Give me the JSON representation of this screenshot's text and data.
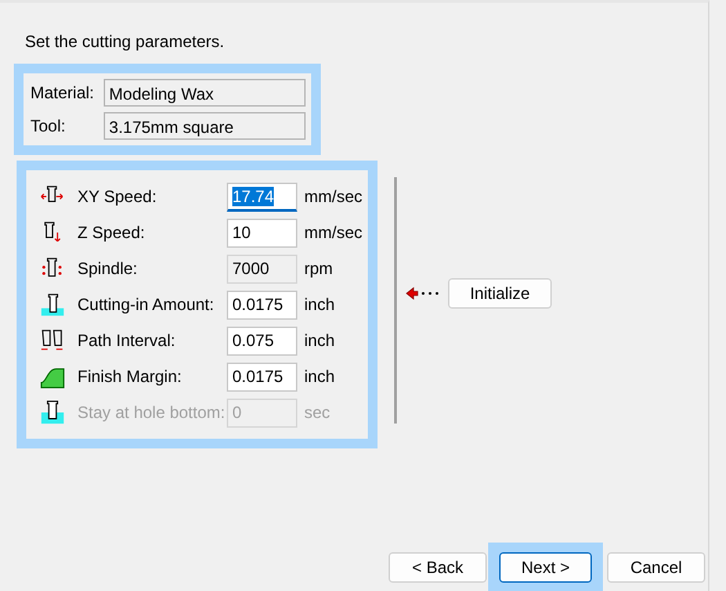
{
  "instruction": "Set the cutting parameters.",
  "tool_info": {
    "highlighted": true,
    "fields": [
      {
        "label": "Material:",
        "value": "Modeling Wax"
      },
      {
        "label": "Tool:",
        "value": "3.175mm square"
      }
    ]
  },
  "parameters": {
    "highlighted": true,
    "rows": [
      {
        "label": "XY Speed:",
        "value": "17.74",
        "unit": "mm/sec",
        "disabled": false,
        "focused": true,
        "readonly": false
      },
      {
        "label": "Z Speed:",
        "value": "10",
        "unit": "mm/sec",
        "disabled": false,
        "focused": false,
        "readonly": false
      },
      {
        "label": "Spindle:",
        "value": "7000",
        "unit": "rpm",
        "disabled": false,
        "focused": false,
        "readonly": true
      },
      {
        "label": "Cutting-in Amount:",
        "value": "0.0175",
        "unit": "inch",
        "disabled": false,
        "focused": false,
        "readonly": false
      },
      {
        "label": "Path Interval:",
        "value": "0.075",
        "unit": "inch",
        "disabled": false,
        "focused": false,
        "readonly": false
      },
      {
        "label": "Finish Margin:",
        "value": "0.0175",
        "unit": "inch",
        "disabled": false,
        "focused": false,
        "readonly": false
      },
      {
        "label": "Stay at hole bottom:",
        "value": "0",
        "unit": "sec",
        "disabled": true,
        "focused": false,
        "readonly": false
      }
    ]
  },
  "initialize_button": "Initialize",
  "buttons": [
    {
      "label": "< Back",
      "highlighted": false,
      "default": false
    },
    {
      "label": "Next >",
      "highlighted": true,
      "default": true
    },
    {
      "label": "Cancel",
      "highlighted": false,
      "default": false
    }
  ]
}
